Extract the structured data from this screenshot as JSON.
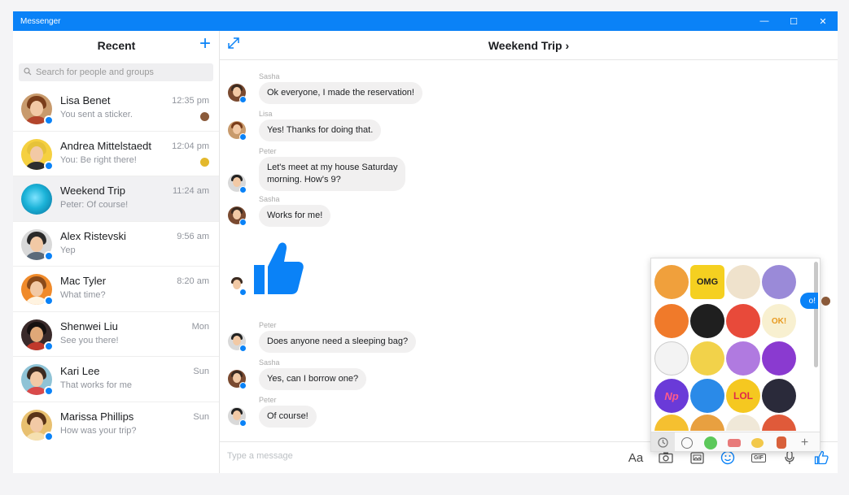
{
  "window": {
    "title": "Messenger",
    "controls": [
      "—",
      "☐",
      "✕"
    ]
  },
  "sidebar": {
    "title": "Recent",
    "new_button": "+",
    "search_placeholder": "Search for people and groups",
    "conversations": [
      {
        "name": "Lisa Benet",
        "preview": "You sent a sticker.",
        "time": "12:35 pm"
      },
      {
        "name": "Andrea Mittelstaedt",
        "preview": "You: Be right there!",
        "time": "12:04 pm"
      },
      {
        "name": "Weekend Trip",
        "preview": "Peter: Of course!",
        "time": "11:24 am"
      },
      {
        "name": "Alex Ristevski",
        "preview": "Yep",
        "time": "9:56 am"
      },
      {
        "name": "Mac Tyler",
        "preview": "What time?",
        "time": "8:20 am"
      },
      {
        "name": "Shenwei Liu",
        "preview": "See you there!",
        "time": "Mon"
      },
      {
        "name": "Kari Lee",
        "preview": "That works for me",
        "time": "Sun"
      },
      {
        "name": "Marissa Phillips",
        "preview": "How was your trip?",
        "time": "Sun"
      }
    ]
  },
  "chat": {
    "title": "Weekend Trip ›",
    "messages": [
      {
        "sender": "Sasha",
        "text": "Ok everyone, I made the reservation!"
      },
      {
        "sender": "Lisa",
        "text": "Yes! Thanks for doing that."
      },
      {
        "sender": "Peter",
        "text": "Let's meet at my house Saturday",
        "text2": "morning. How's 9?"
      },
      {
        "sender": "Sasha",
        "text": "Works for me!"
      },
      {
        "sender": "Peter",
        "text": "Does anyone need a sleeping bag?"
      },
      {
        "sender": "Sasha",
        "text": "Yes, can I borrow one?"
      },
      {
        "sender": "Peter",
        "text": "Of course!"
      }
    ],
    "peek_text": "o!",
    "composer_placeholder": "Type a message"
  },
  "toolbar": {
    "font": "Aa",
    "gif": "GIF"
  },
  "stickers": {
    "labels": [
      "OMG",
      "OK!",
      "Np",
      "LOL"
    ],
    "tabs_plus": "+"
  },
  "colors": {
    "accent": "#0a82f7"
  }
}
